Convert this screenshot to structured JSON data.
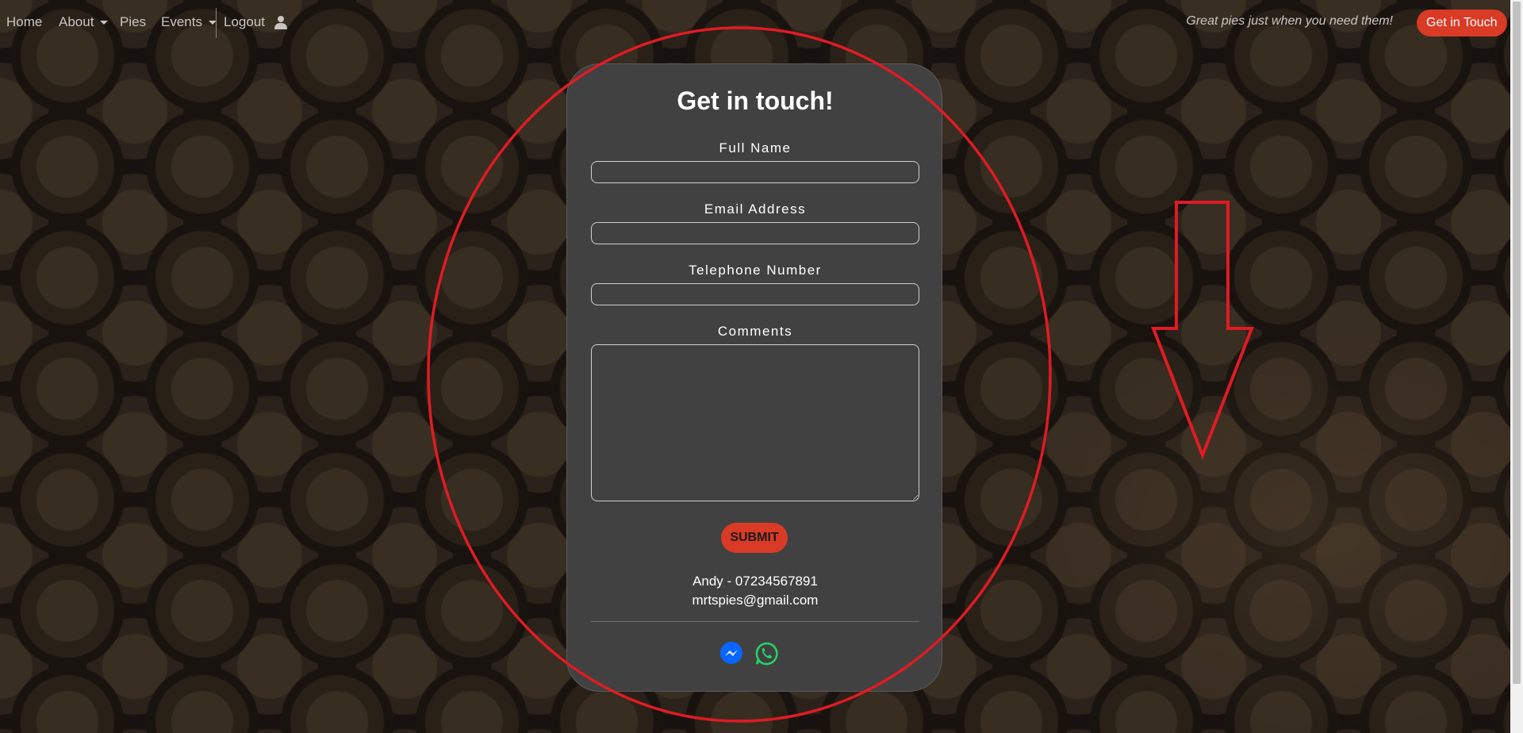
{
  "nav": {
    "items": [
      {
        "label": "Home",
        "dropdown": false
      },
      {
        "label": "About",
        "dropdown": true
      },
      {
        "label": "Pies",
        "dropdown": false
      },
      {
        "label": "Events",
        "dropdown": true
      },
      {
        "label": "Logout",
        "dropdown": false
      }
    ],
    "user_icon": "user-icon",
    "tagline": "Great pies just when you need them!",
    "cta_label": "Get in Touch"
  },
  "form": {
    "title": "Get in touch!",
    "fields": [
      {
        "label": "Full Name",
        "value": ""
      },
      {
        "label": "Email Address",
        "value": ""
      },
      {
        "label": "Telephone Number",
        "value": ""
      },
      {
        "label": "Comments",
        "value": ""
      }
    ],
    "submit_label": "SUBMIT"
  },
  "contact": {
    "phone_line": "Andy - 07234567891",
    "email": "mrtspies@gmail.com"
  },
  "social": [
    {
      "icon": "messenger-icon",
      "color": "#0866ff"
    },
    {
      "icon": "whatsapp-icon",
      "color": "#25d366"
    }
  ],
  "colors": {
    "accent": "#d93b26",
    "card": "#414141",
    "annotation": "#e01b24"
  }
}
